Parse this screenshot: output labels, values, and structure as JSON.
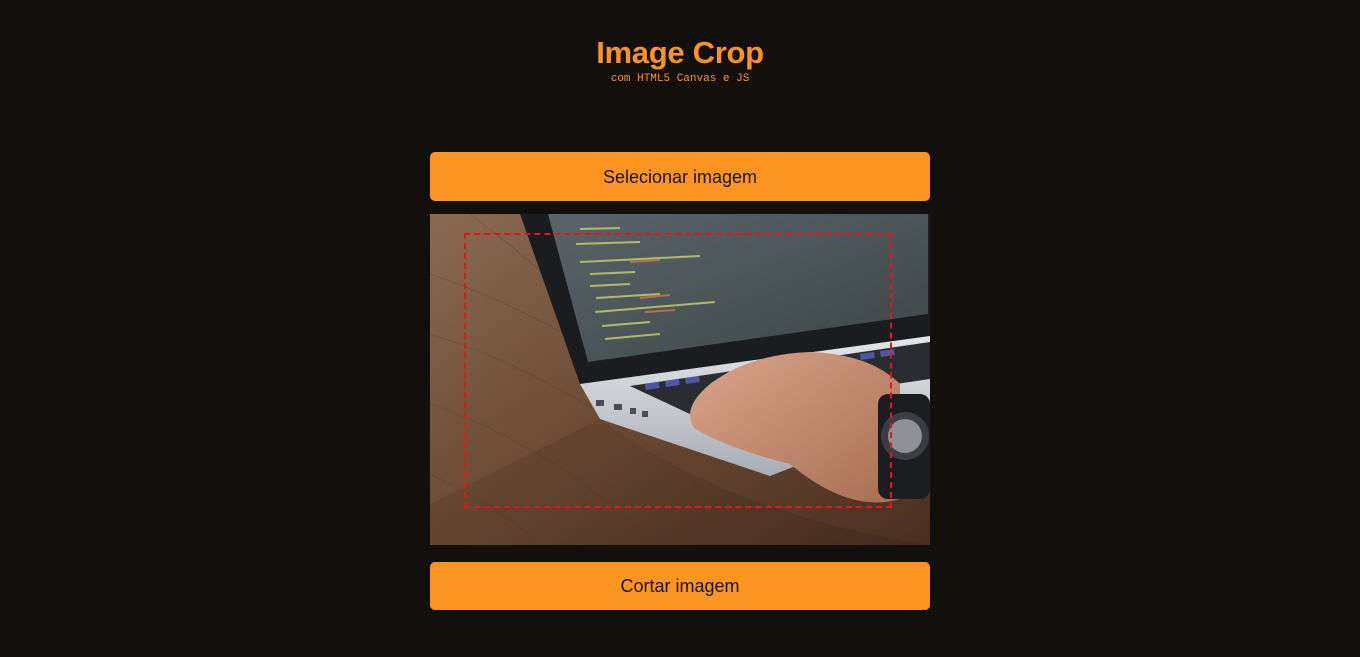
{
  "header": {
    "title": "Image Crop",
    "subtitle": "com HTML5 Canvas e JS"
  },
  "buttons": {
    "select_label": "Selecionar imagem",
    "crop_label": "Cortar imagem"
  },
  "colors": {
    "background": "#120f0d",
    "accent": "#fd9522",
    "crop_border": "#e8141b"
  }
}
